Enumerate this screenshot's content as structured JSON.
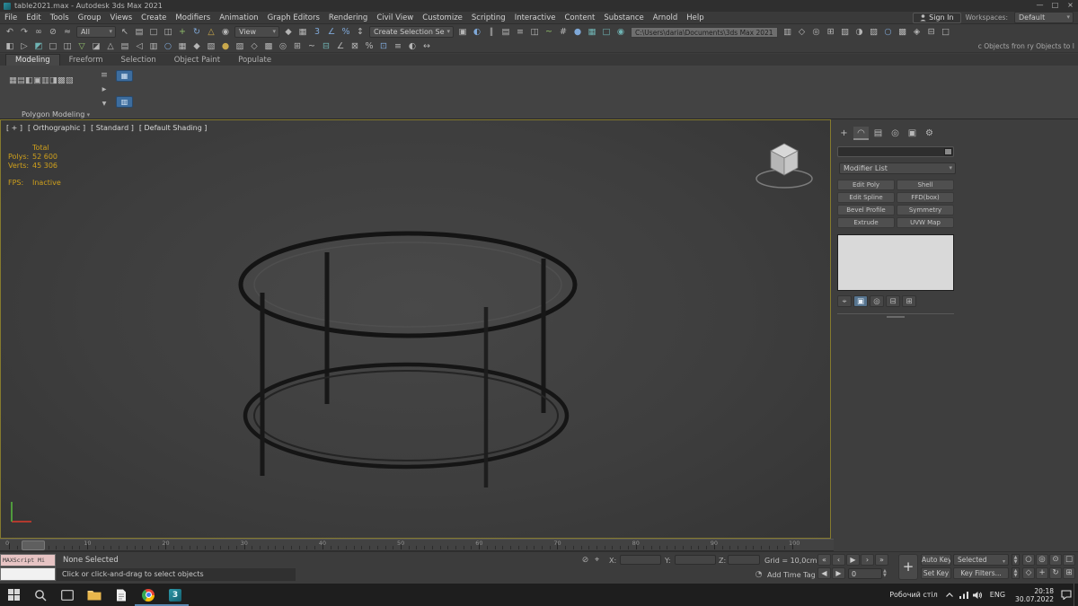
{
  "colors": {
    "accent_blue": "#3d6d9e",
    "stats_yellow": "#cfa01c",
    "viewport_border": "#857a2e",
    "running_underline": "#5a87b0"
  },
  "window": {
    "title": "table2021.max - Autodesk 3ds Max 2021",
    "controls": [
      {
        "n": "minimize-button",
        "g": "—"
      },
      {
        "n": "maximize-button",
        "g": "□"
      },
      {
        "n": "close-button",
        "g": "×"
      }
    ]
  },
  "menubar": {
    "items": [
      "File",
      "Edit",
      "Tools",
      "Group",
      "Views",
      "Create",
      "Modifiers",
      "Animation",
      "Graph Editors",
      "Rendering",
      "Civil View",
      "Customize",
      "Scripting",
      "Interactive",
      "Content",
      "Substance",
      "Arnold",
      "Help"
    ],
    "sign_in": "Sign In",
    "workspaces_label": "Workspaces:",
    "workspace_value": "Default"
  },
  "toolbar": {
    "filter_value": "All",
    "view_value": "View",
    "named_selection_value": "Create Selection Se",
    "path_value": "C:\\Users\\daria\\Documents\\3ds Max 2021",
    "right_text": "c Objects fron   ry Objects to I",
    "row1_a": [
      {
        "n": "undo-icon",
        "g": "↶"
      },
      {
        "n": "redo-icon",
        "g": "↷"
      },
      {
        "n": "select-and-link-icon",
        "g": "∞"
      },
      {
        "n": "unlink-selection-icon",
        "g": "⊘"
      },
      {
        "n": "bind-to-space-warp-icon",
        "g": "≈"
      }
    ],
    "row1_b": [
      {
        "n": "select-object-icon",
        "g": "↖"
      },
      {
        "n": "select-by-name-icon",
        "g": "▤"
      },
      {
        "n": "rectangular-selection-icon",
        "g": "□"
      },
      {
        "n": "window-crossing-icon",
        "g": "◫"
      },
      {
        "n": "select-and-move-icon",
        "g": "+",
        "c": "c-green"
      },
      {
        "n": "select-and-rotate-icon",
        "g": "↻",
        "c": "c-blue"
      },
      {
        "n": "select-and-scale-icon",
        "g": "△",
        "c": "c-yellow"
      },
      {
        "n": "use-pivot-center-icon",
        "g": "◉"
      }
    ],
    "row1_c": [
      {
        "n": "select-and-manipulate-icon",
        "g": "◆"
      },
      {
        "n": "keyboard-override-icon",
        "g": "▦"
      },
      {
        "n": "snap-toggle-icon",
        "g": "3",
        "c": "c-blue"
      },
      {
        "n": "angle-snap-icon",
        "g": "∠",
        "c": "c-blue"
      },
      {
        "n": "percent-snap-icon",
        "g": "%",
        "c": "c-blue"
      },
      {
        "n": "spinner-snap-icon",
        "g": "↕"
      }
    ],
    "row1_d": [
      {
        "n": "edit-named-selection-sets-icon",
        "g": "▣"
      },
      {
        "n": "mirror-icon",
        "g": "◐",
        "c": "c-blue"
      },
      {
        "n": "align-icon",
        "g": "∥"
      },
      {
        "n": "layer-manager-icon",
        "g": "▤"
      },
      {
        "n": "scene-explorer-icon",
        "g": "≡"
      },
      {
        "n": "ribbon-toggle-icon",
        "g": "◫"
      },
      {
        "n": "curve-editor-icon",
        "g": "~",
        "c": "c-green"
      },
      {
        "n": "schematic-view-icon",
        "g": "#"
      },
      {
        "n": "material-editor-icon",
        "g": "●",
        "c": "c-blue"
      },
      {
        "n": "render-setup-icon",
        "g": "▦",
        "c": "c-teal"
      },
      {
        "n": "rendered-frame-icon",
        "g": "□",
        "c": "c-teal"
      },
      {
        "n": "render-production-icon",
        "g": "◉",
        "c": "c-teal"
      }
    ],
    "row1_e": [
      {
        "n": "toolbar-icon-1",
        "g": "▥"
      },
      {
        "n": "toolbar-icon-2",
        "g": "◇"
      },
      {
        "n": "toolbar-icon-3",
        "g": "◎"
      },
      {
        "n": "toolbar-icon-4",
        "g": "⊞"
      },
      {
        "n": "toolbar-icon-5",
        "g": "▧"
      },
      {
        "n": "toolbar-icon-6",
        "g": "◑"
      },
      {
        "n": "toolbar-icon-7",
        "g": "▨"
      },
      {
        "n": "toolbar-icon-8",
        "g": "○",
        "c": "c-blue"
      },
      {
        "n": "toolbar-icon-9",
        "g": "▩"
      },
      {
        "n": "toolbar-icon-10",
        "g": "◈"
      },
      {
        "n": "toolbar-icon-11",
        "g": "⊟"
      },
      {
        "n": "toolbar-icon-12",
        "g": "□"
      }
    ],
    "row2": [
      {
        "n": "toolbar2-icon-1",
        "g": "◧"
      },
      {
        "n": "toolbar2-icon-2",
        "g": "▷"
      },
      {
        "n": "toolbar2-icon-3",
        "g": "◩",
        "c": "c-teal"
      },
      {
        "n": "toolbar2-icon-4",
        "g": "□"
      },
      {
        "n": "toolbar2-icon-5",
        "g": "◫"
      },
      {
        "n": "toolbar2-icon-6",
        "g": "▽",
        "c": "c-green"
      },
      {
        "n": "toolbar2-icon-7",
        "g": "◪"
      },
      {
        "n": "toolbar2-icon-8",
        "g": "△"
      },
      {
        "n": "toolbar2-icon-9",
        "g": "▤"
      },
      {
        "n": "toolbar2-icon-10",
        "g": "◁"
      },
      {
        "n": "toolbar2-icon-11",
        "g": "▥"
      },
      {
        "n": "toolbar2-icon-12",
        "g": "○",
        "c": "c-blue"
      },
      {
        "n": "toolbar2-icon-13",
        "g": "▦"
      },
      {
        "n": "toolbar2-icon-14",
        "g": "◆"
      },
      {
        "n": "toolbar2-icon-15",
        "g": "▧"
      },
      {
        "n": "toolbar2-icon-16",
        "g": "●",
        "c": "c-yellow"
      },
      {
        "n": "toolbar2-icon-17",
        "g": "▨"
      },
      {
        "n": "toolbar2-icon-18",
        "g": "◇"
      },
      {
        "n": "toolbar2-icon-19",
        "g": "▩"
      },
      {
        "n": "toolbar2-icon-20",
        "g": "◎"
      },
      {
        "n": "toolbar2-icon-21",
        "g": "⊞"
      },
      {
        "n": "toolbar2-icon-22",
        "g": "~"
      },
      {
        "n": "toolbar2-icon-23",
        "g": "⊟",
        "c": "c-teal"
      },
      {
        "n": "toolbar2-icon-24",
        "g": "∠"
      },
      {
        "n": "toolbar2-icon-25",
        "g": "⊠"
      },
      {
        "n": "toolbar2-icon-26",
        "g": "%"
      },
      {
        "n": "toolbar2-icon-27",
        "g": "⊡",
        "c": "c-blue"
      },
      {
        "n": "toolbar2-icon-28",
        "g": "≡"
      },
      {
        "n": "toolbar2-icon-29",
        "g": "◐"
      },
      {
        "n": "toolbar2-icon-30",
        "g": "↔"
      }
    ]
  },
  "ribbon": {
    "tabs": [
      "Modeling",
      "Freeform",
      "Selection",
      "Object Paint",
      "Populate"
    ],
    "active": "Modeling",
    "panel_label": "Polygon Modeling",
    "buttons": [
      {
        "n": "ribbon-button-1",
        "g": "▦"
      },
      {
        "n": "ribbon-button-2",
        "g": "▤"
      },
      {
        "n": "ribbon-button-3",
        "g": "◧"
      },
      {
        "n": "ribbon-button-4",
        "g": "▣"
      },
      {
        "n": "ribbon-button-5",
        "g": "▥"
      },
      {
        "n": "ribbon-button-6",
        "g": "◨"
      },
      {
        "n": "ribbon-button-7",
        "g": "▩"
      },
      {
        "n": "ribbon-button-8",
        "g": "▧"
      }
    ],
    "side_icons": [
      {
        "n": "ribbon-side-icon-1",
        "g": "≡"
      },
      {
        "n": "ribbon-side-icon-2",
        "g": "▸"
      },
      {
        "n": "ribbon-side-icon-3",
        "g": "▾"
      }
    ],
    "highlight_icons": [
      {
        "n": "ribbon-highlight-icon-1",
        "g": "▦",
        "c": "hl"
      },
      {
        "n": "ribbon-highlight-icon-2",
        "g": "▥",
        "c": "hl"
      }
    ]
  },
  "viewport": {
    "label_parts": [
      "[ + ]",
      "[ Orthographic ]",
      "[ Standard ]",
      "[ Default Shading ]"
    ],
    "stats": {
      "total_label": "Total",
      "polys_label": "Polys:",
      "polys_value": "52 600",
      "verts_label": "Verts:",
      "verts_value": "45 306",
      "fps_label": "FPS:",
      "fps_value": "Inactive"
    }
  },
  "command_panel": {
    "tabs": [
      {
        "n": "create-tab-icon",
        "g": "+"
      },
      {
        "n": "modify-tab-icon",
        "g": "◠",
        "c": "active"
      },
      {
        "n": "hierarchy-tab-icon",
        "g": "▤"
      },
      {
        "n": "motion-tab-icon",
        "g": "◎"
      },
      {
        "n": "display-tab-icon",
        "g": "▣"
      },
      {
        "n": "utilities-tab-icon",
        "g": "⚙"
      }
    ],
    "modifier_list": "Modifier List",
    "modifier_buttons": [
      "Edit Poly",
      "Shell",
      "Edit Spline",
      "FFD(box)",
      "Bevel Profile",
      "Symmetry",
      "Extrude",
      "UVW Map"
    ],
    "stack_icons": [
      {
        "n": "pin-stack-icon",
        "g": "⌖"
      },
      {
        "n": "show-end-result-icon",
        "g": "▣",
        "c": "active"
      },
      {
        "n": "make-unique-icon",
        "g": "◎"
      },
      {
        "n": "remove-modifier-icon",
        "g": "⊟"
      },
      {
        "n": "configure-modifier-sets-icon",
        "g": "⊞"
      }
    ]
  },
  "timeline": {
    "frame_numbers": [
      "0",
      "10",
      "20",
      "30",
      "40",
      "50",
      "60",
      "70",
      "80",
      "90",
      "100"
    ]
  },
  "status": {
    "maxscript_label": "MAXScript Mi",
    "selection": "None Selected",
    "prompt": "Click or click-and-drag to select objects",
    "x_label": "X:",
    "y_label": "Y:",
    "z_label": "Z:",
    "grid_label": "Grid = 10,0cm",
    "add_time_tag": "Add Time Tag",
    "frame": "0",
    "auto_key": "Auto Key",
    "selected_value": "Selected",
    "set_key": "Set Key",
    "key_filters": "Key Filters...",
    "pre_icons": [
      {
        "n": "selection-lock-icon",
        "g": "⊘"
      },
      {
        "n": "absolute-mode-icon",
        "g": "⌖"
      }
    ],
    "time_tag_icon": "◔",
    "playback": [
      {
        "n": "go-to-start-button",
        "g": "«"
      },
      {
        "n": "previous-frame-button",
        "g": "‹"
      },
      {
        "n": "play-button",
        "g": "▶"
      },
      {
        "n": "next-frame-button",
        "g": "›"
      },
      {
        "n": "go-to-end-button",
        "g": "»"
      }
    ],
    "key_buttons": [
      {
        "n": "previous-key-button",
        "g": "◀"
      },
      {
        "n": "next-key-button",
        "g": "▶"
      }
    ],
    "nav_row1": [
      {
        "n": "zoom-icon",
        "g": "○"
      },
      {
        "n": "zoom-all-icon",
        "g": "◎"
      },
      {
        "n": "zoom-extents-icon",
        "g": "⊙"
      },
      {
        "n": "zoom-region-icon",
        "g": "□"
      }
    ],
    "nav_row2": [
      {
        "n": "field-of-view-icon",
        "g": "◇"
      },
      {
        "n": "pan-icon",
        "g": "+"
      },
      {
        "n": "orbit-icon",
        "g": "↻"
      },
      {
        "n": "maximize-viewport-icon",
        "g": "⊞"
      }
    ]
  },
  "taskbar": {
    "desktop_label": "Робочий стіл",
    "language": "ENG",
    "time": "20:18",
    "date": "30.07.2022",
    "max_letter": "3"
  }
}
